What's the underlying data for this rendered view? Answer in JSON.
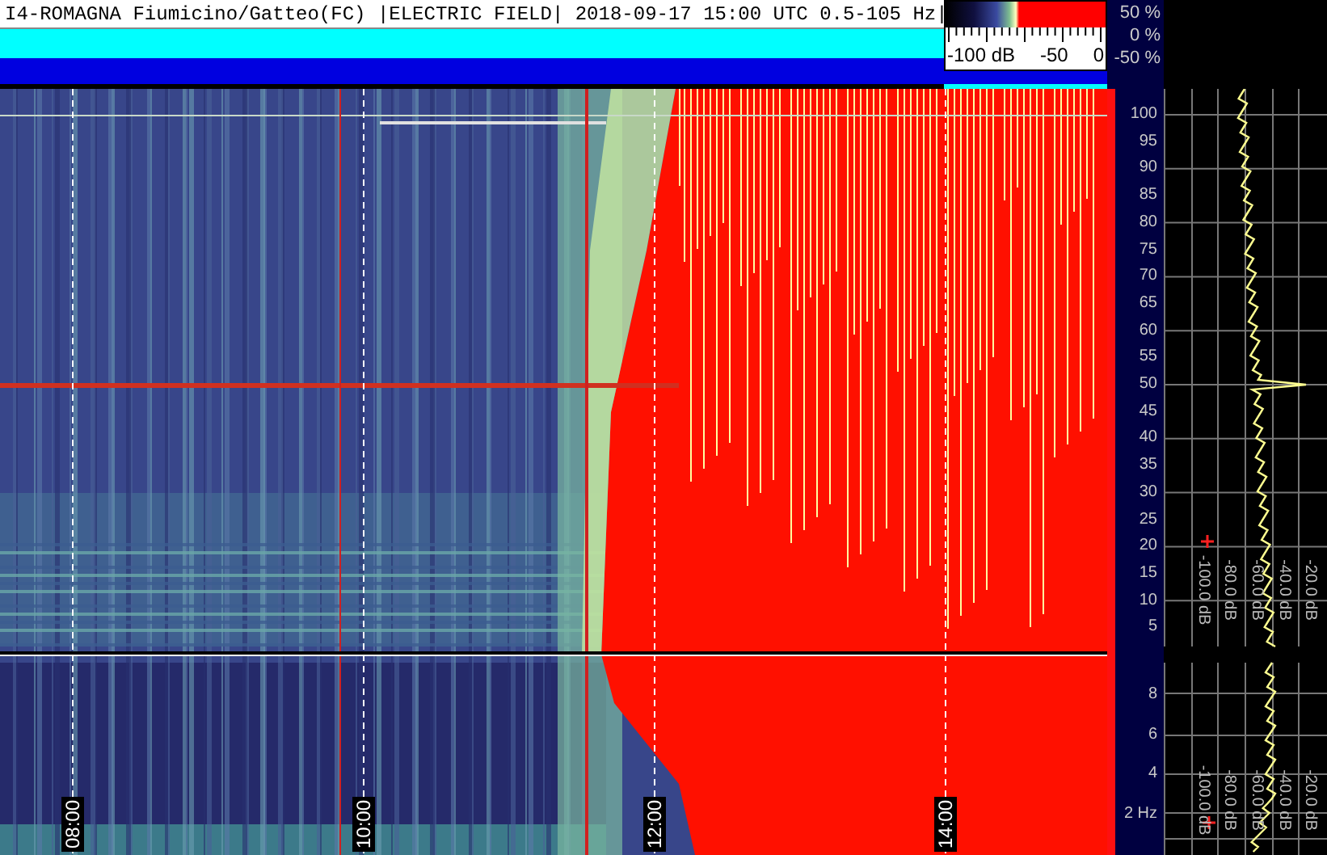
{
  "header": {
    "title": "I4-ROMAGNA Fiumicino/Gatteo(FC) |ELECTRIC FIELD| 2018-09-17 15:00 UTC 0.5-105 Hz|"
  },
  "color_scale": {
    "labels": [
      "-100 dB",
      "-50",
      "0"
    ]
  },
  "percent_scale": {
    "labels": [
      "50 %",
      "0 %",
      "-50 %"
    ]
  },
  "spectrogram": {
    "time_labels": [
      "08:00",
      "10:00",
      "12:00",
      "14:00"
    ]
  },
  "frequency_axis": {
    "upper_labels": [
      "100",
      "95",
      "90",
      "85",
      "80",
      "75",
      "70",
      "65",
      "60",
      "55",
      "50",
      "45",
      "40",
      "35",
      "30",
      "25",
      "20",
      "15",
      "10",
      "5"
    ],
    "lower_labels": [
      "8",
      "6",
      "4",
      "2 Hz"
    ]
  },
  "spectrum": {
    "upper_db_labels": [
      "-100.0 dB",
      "-80.0 dB",
      "-60.0 dB",
      "-40.0 dB",
      "-20.0 dB"
    ],
    "lower_db_labels": [
      "-100.0 dB",
      "-80.0 dB",
      "-60.0 dB",
      "-40.0 dB",
      "-20.0 dB"
    ]
  }
}
